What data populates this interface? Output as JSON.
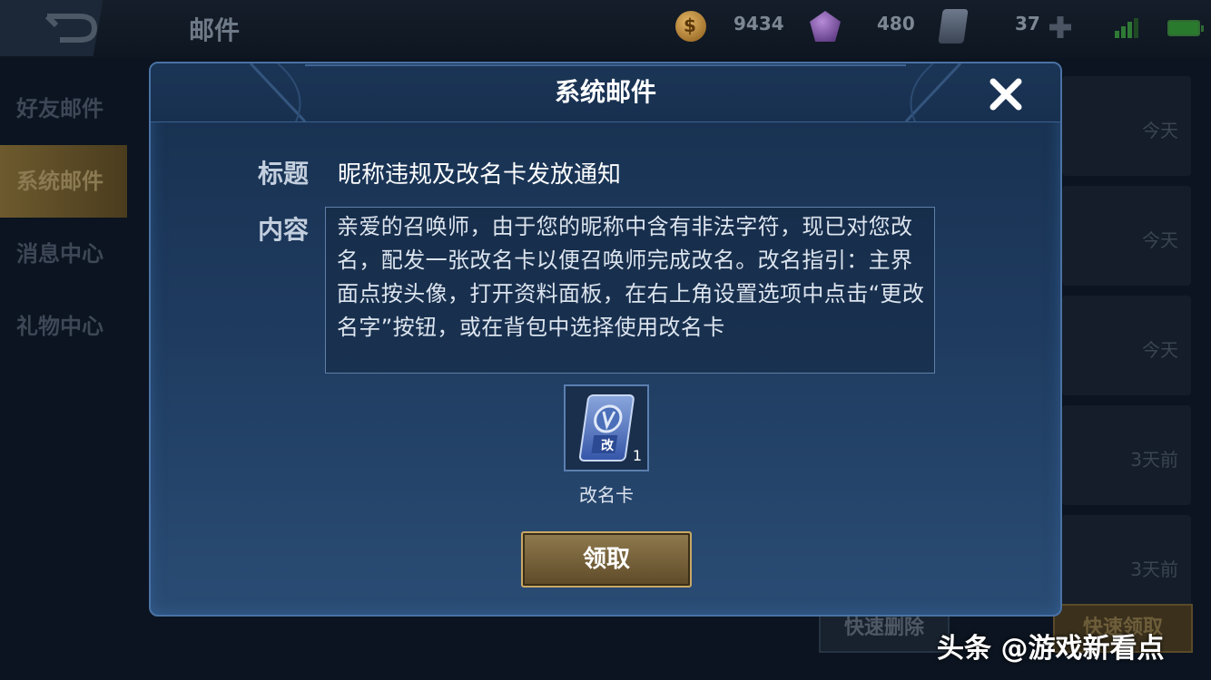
{
  "header": {
    "page_title": "邮件",
    "resources": [
      {
        "icon": "coin-icon",
        "value": "9434"
      },
      {
        "icon": "gem-icon",
        "value": "480"
      },
      {
        "icon": "card-icon",
        "value": "37"
      }
    ]
  },
  "sidebar": {
    "items": [
      {
        "label": "好友邮件",
        "active": false
      },
      {
        "label": "系统邮件",
        "active": true
      },
      {
        "label": "消息中心",
        "active": false
      },
      {
        "label": "礼物中心",
        "active": false
      }
    ]
  },
  "mail_list": {
    "dates": [
      "今天",
      "今天",
      "今天",
      "3天前",
      "3天前"
    ]
  },
  "bottom_buttons": {
    "delete_label": "快速删除",
    "quick_label": "快速领取"
  },
  "dialog": {
    "title": "系统邮件",
    "subject_label": "标题",
    "subject_value": "昵称违规及改名卡发放通知",
    "content_label": "内容",
    "content_text": "亲爱的召唤师，由于您的昵称中含有非法字符，现已对您改名，配发一张改名卡以便召唤师完成改名。改名指引：主界面点按头像，打开资料面板，在右上角设置选项中点击“更改名字”按钮，或在背包中选择使用改名卡",
    "reward": {
      "name": "改名卡",
      "quantity": "1",
      "icon": "rename-card-icon",
      "icon_char": "改"
    },
    "claim_label": "领取"
  },
  "watermark": "头条 @游戏新看点",
  "colors": {
    "accent_gold": "#c9a865",
    "dialog_border": "#4a72a4",
    "dialog_bg": "#1e3a5e"
  }
}
